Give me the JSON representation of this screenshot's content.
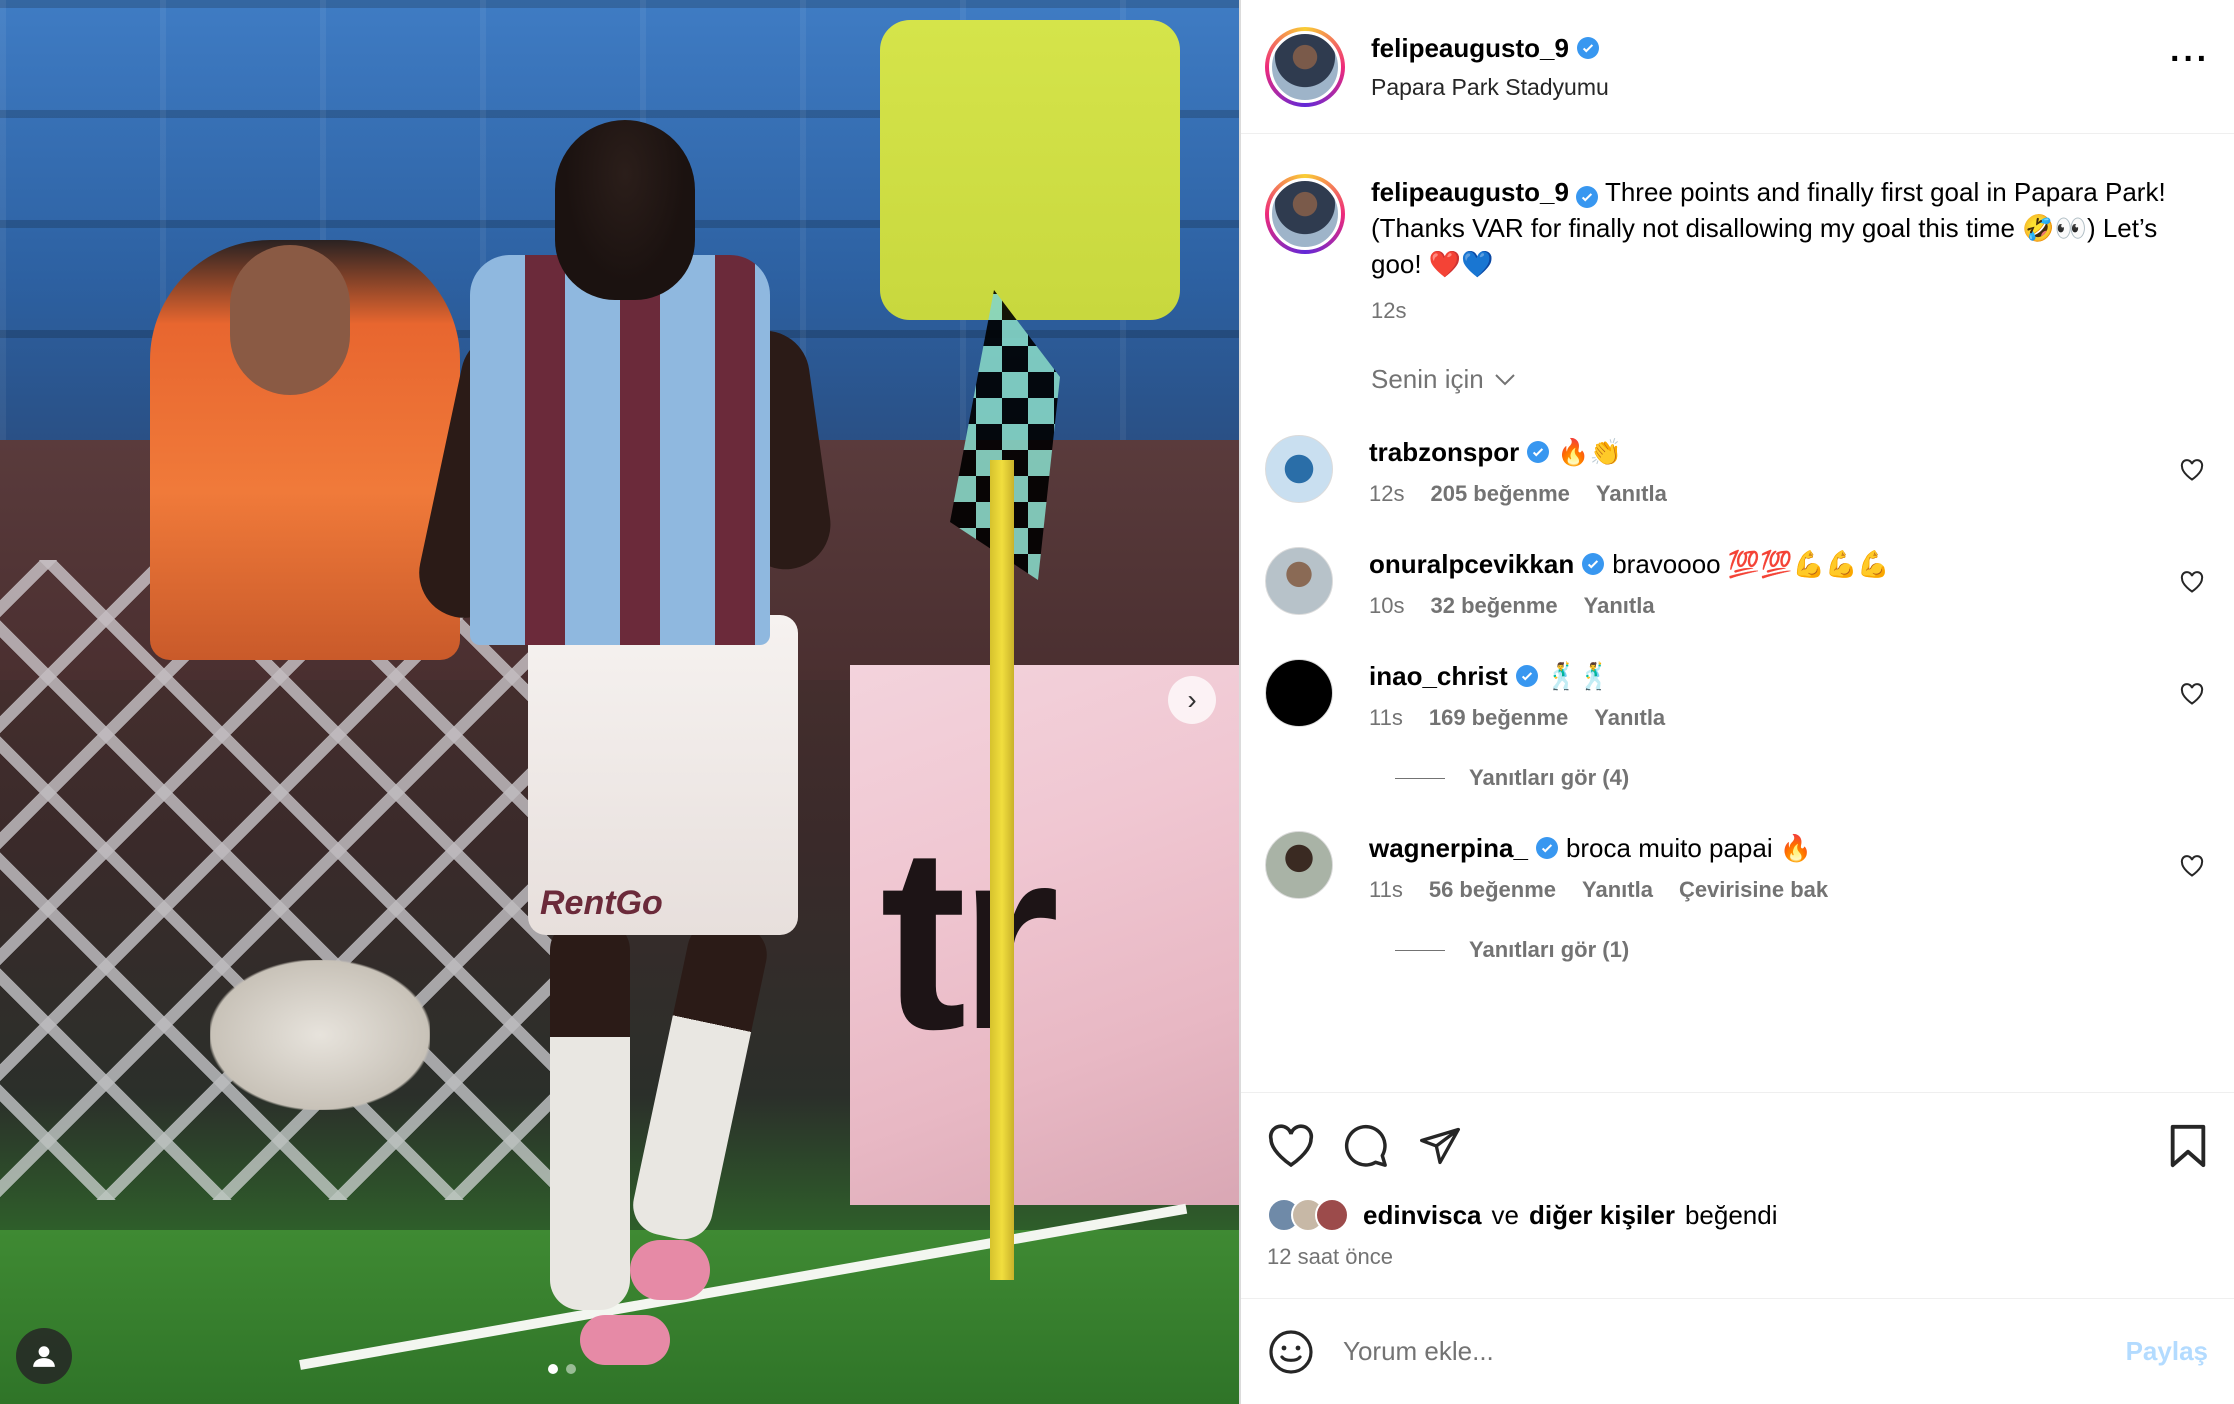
{
  "post": {
    "username": "felipeaugusto_9",
    "location": "Papara Park Stadyumu",
    "more_label": "···",
    "caption_text": "Three points and finally first goal in Papara Park! (Thanks VAR for finally not disallowing my goal this time 🤣👀) Let’s goo! ❤️💙",
    "caption_time": "12s"
  },
  "media": {
    "board_text": "tr",
    "shorts_text": "RentGo",
    "slides": 2,
    "active_slide": 1,
    "next_icon": "chevron-right-icon"
  },
  "filter": {
    "label": "Senin için"
  },
  "comments": [
    {
      "username": "trabzonspor",
      "verified": true,
      "text": "🔥👏",
      "time": "12s",
      "likes": "205 beğenme",
      "reply": "Yanıtla",
      "translate": "",
      "avatar_color": "#c9dff0"
    },
    {
      "username": "onuralpcevikkan",
      "verified": true,
      "text": "bravoooo 💯💯💪💪💪",
      "time": "10s",
      "likes": "32 beğenme",
      "reply": "Yanıtla",
      "translate": "",
      "avatar_color": "#b7c2c9"
    },
    {
      "username": "inao_christ",
      "verified": true,
      "text": "🕺🕺",
      "time": "11s",
      "likes": "169 beğenme",
      "reply": "Yanıtla",
      "translate": "",
      "avatar_color": "#000000",
      "replies_label": "Yanıtları gör (4)"
    },
    {
      "username": "wagnerpina_",
      "verified": true,
      "text": "broca muito papai 🔥",
      "time": "11s",
      "likes": "56 beğenme",
      "reply": "Yanıtla",
      "translate": "Çevirisine bak",
      "avatar_color": "#a9b3a6",
      "replies_label": "Yanıtları gör (1)"
    }
  ],
  "likes": {
    "user": "edinvisca",
    "joiner": "ve",
    "others": "diğer kişiler",
    "suffix": "beğendi",
    "ago": "12 saat önce"
  },
  "composer": {
    "placeholder": "Yorum ekle...",
    "post_label": "Paylaş"
  },
  "colors": {
    "verified": "#3897f0",
    "muted": "#737373",
    "post_disabled": "#b3dbff"
  }
}
